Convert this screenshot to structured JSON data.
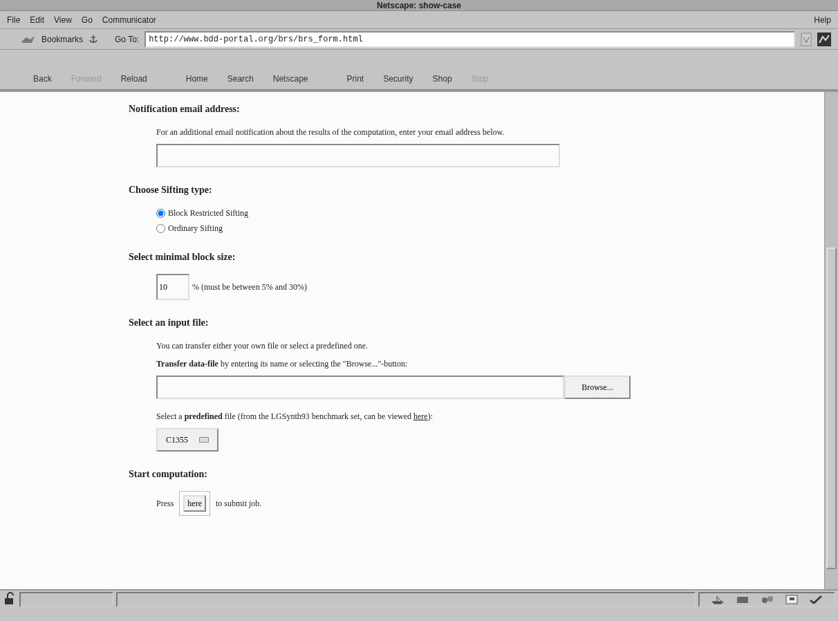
{
  "window": {
    "title": "Netscape: show-case"
  },
  "menu_bar": {
    "items": [
      {
        "label": "File"
      },
      {
        "label": "Edit"
      },
      {
        "label": "View"
      },
      {
        "label": "Go"
      },
      {
        "label": "Communicator"
      }
    ],
    "help": "Help"
  },
  "location": {
    "bookmarks": "Bookmarks",
    "goto_label": "Go To:",
    "url": "http://www.bdd-portal.org/brs/brs_form.html"
  },
  "toolbar": [
    {
      "label": "Back",
      "disabled": false
    },
    {
      "label": "Forward",
      "disabled": true
    },
    {
      "label": "Reload",
      "disabled": false
    },
    {
      "label": "Home",
      "disabled": false
    },
    {
      "label": "Search",
      "disabled": false
    },
    {
      "label": "Netscape",
      "disabled": false
    },
    {
      "label": "Print",
      "disabled": false
    },
    {
      "label": "Security",
      "disabled": false
    },
    {
      "label": "Shop",
      "disabled": false
    },
    {
      "label": "Stop",
      "disabled": true
    }
  ],
  "sections": [
    {
      "heading": "Notification email address:",
      "items": [
        {
          "kind": "text",
          "text": "For an additional email notification about the results of the computation, enter your email address below."
        },
        {
          "kind": "input"
        }
      ]
    },
    {
      "heading": "Choose Sifting type:",
      "items": [
        {
          "kind": "radio",
          "options": [
            {
              "label": "Block Restricted Sifting",
              "selected": true
            },
            {
              "label": "Ordinary Sifting",
              "selected": false
            }
          ]
        }
      ]
    },
    {
      "heading": "Select minimal block size:",
      "items": [
        {
          "kind": "size",
          "value": "10",
          "suffix": "% (must be between 5% and 30%)"
        }
      ]
    },
    {
      "heading": "Select an input file:",
      "items": [
        {
          "kind": "text",
          "text": "You can transfer either your own file or select a predefined one."
        },
        {
          "kind": "text",
          "text": "**Transfer data-file** by entering its name or selecting the \"Browse...\"-button:"
        },
        {
          "kind": "file",
          "button": "Browse..."
        },
        {
          "kind": "linktext",
          "before": "Select a **predefined** file (from the LGSynth93 benchmark set, can be viewed ",
          "link": "here",
          "after": "):"
        },
        {
          "kind": "select",
          "value": "C1355"
        }
      ]
    },
    {
      "heading": "Start computation:",
      "items": [
        {
          "kind": "submit",
          "before": "Press",
          "button": "here",
          "after": "to submit job."
        }
      ]
    }
  ]
}
